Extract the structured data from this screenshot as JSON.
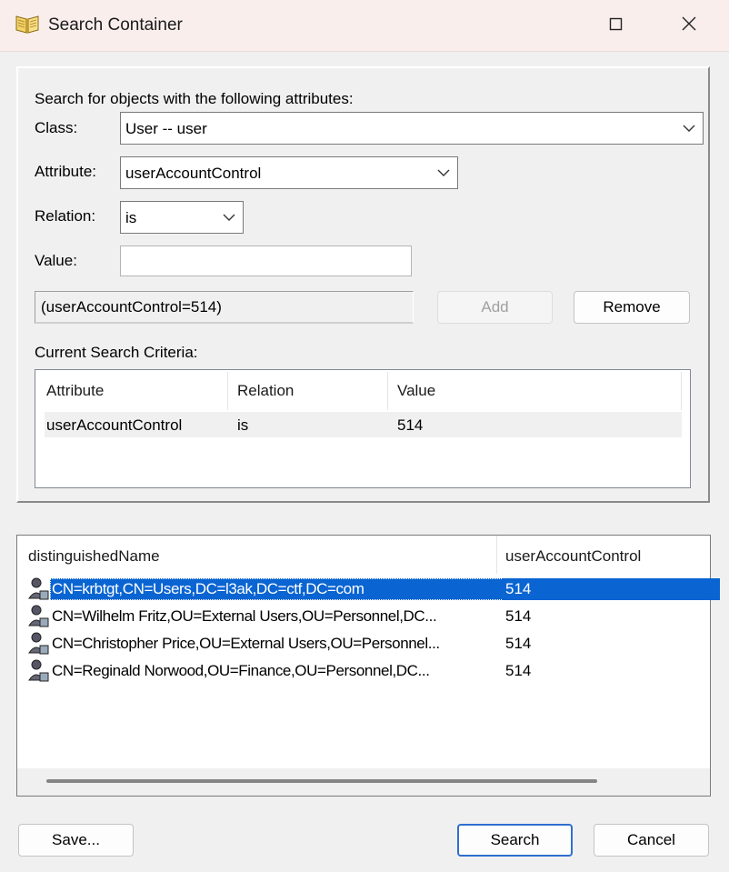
{
  "window": {
    "title": "Search Container"
  },
  "criteria_panel": {
    "heading": "Search for objects with the following attributes:",
    "class_label": "Class:",
    "class_value": "User  --  user",
    "attribute_label": "Attribute:",
    "attribute_value": "userAccountControl",
    "relation_label": "Relation:",
    "relation_value": "is",
    "value_label": "Value:",
    "value_input": "",
    "filter_preview": "(userAccountControl=514)",
    "add_label": "Add",
    "remove_label": "Remove",
    "current_criteria_label": "Current Search Criteria:",
    "criteria_columns": [
      "Attribute",
      "Relation",
      "Value"
    ],
    "criteria_rows": [
      {
        "attribute": "userAccountControl",
        "relation": "is",
        "value": "514"
      }
    ]
  },
  "results": {
    "columns": [
      "distinguishedName",
      "userAccountControl"
    ],
    "rows": [
      {
        "dn": "CN=krbtgt,CN=Users,DC=l3ak,DC=ctf,DC=com",
        "uac": "514",
        "selected": true
      },
      {
        "dn": "CN=Wilhelm Fritz,OU=External Users,OU=Personnel,DC...",
        "uac": "514",
        "selected": false
      },
      {
        "dn": "CN=Christopher Price,OU=External Users,OU=Personnel...",
        "uac": "514",
        "selected": false
      },
      {
        "dn": "CN=Reginald Norwood,OU=Finance,OU=Personnel,DC...",
        "uac": "514",
        "selected": false
      }
    ]
  },
  "footer": {
    "save_label": "Save...",
    "search_label": "Search",
    "cancel_label": "Cancel"
  },
  "colors": {
    "titlebar": "#f9eeec",
    "selection": "#0a64d2",
    "default_button_border": "#2f6fd0"
  }
}
